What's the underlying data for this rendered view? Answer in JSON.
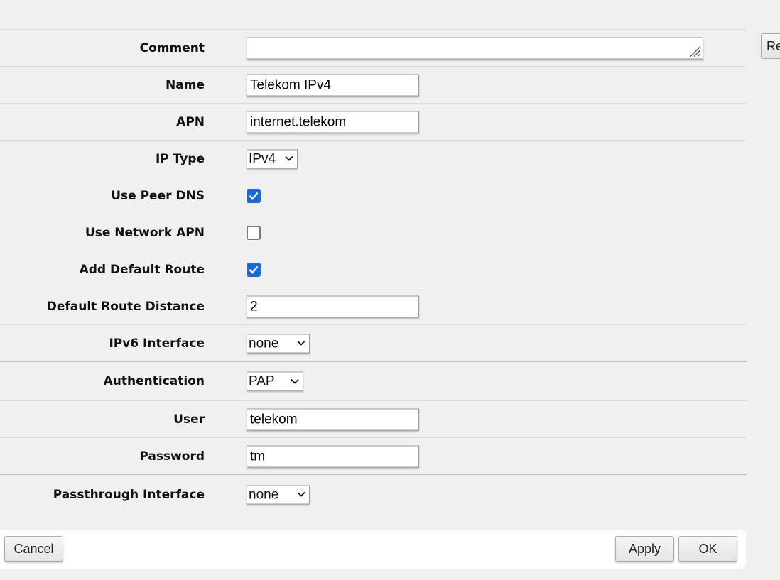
{
  "form": {
    "comment": {
      "label": "Comment",
      "value": ""
    },
    "name": {
      "label": "Name",
      "value": "Telekom IPv4"
    },
    "apn": {
      "label": "APN",
      "value": "internet.telekom"
    },
    "ip_type": {
      "label": "IP Type",
      "value": "IPv4"
    },
    "use_peer_dns": {
      "label": "Use Peer DNS",
      "checked": true
    },
    "use_network_apn": {
      "label": "Use Network APN",
      "checked": false
    },
    "add_default_route": {
      "label": "Add Default Route",
      "checked": true
    },
    "default_route_distance": {
      "label": "Default Route Distance",
      "value": "2"
    },
    "ipv6_interface": {
      "label": "IPv6 Interface",
      "value": "none"
    },
    "authentication": {
      "label": "Authentication",
      "value": "PAP"
    },
    "user": {
      "label": "User",
      "value": "telekom"
    },
    "password": {
      "label": "Password",
      "value": "tm"
    },
    "passthrough_interface": {
      "label": "Passthrough Interface",
      "value": "none"
    }
  },
  "footer": {
    "cancel_label": "Cancel",
    "apply_label": "Apply",
    "ok_label": "OK"
  },
  "side": {
    "edge_button_label": "Re"
  },
  "colors": {
    "accent": "#1a6ad8",
    "background": "#f0f0f0"
  },
  "icons": {
    "checkbox_checked": "check-icon",
    "select_arrow": "chevron-down-icon",
    "resize": "resize-grip-icon"
  }
}
